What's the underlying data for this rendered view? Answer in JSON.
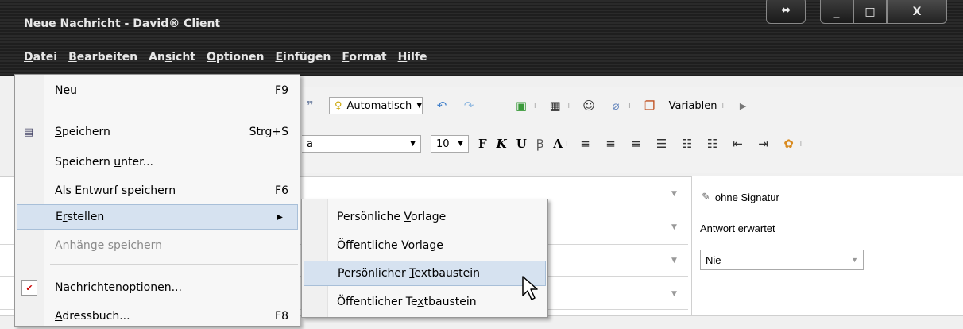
{
  "window": {
    "title": "Neue Nachricht - David® Client",
    "buttons": {
      "resize_icon": "⇔",
      "minimize_icon": "_",
      "maximize_icon": "□",
      "close_icon": "X"
    }
  },
  "menubar": [
    {
      "key": "D",
      "rest": "atei"
    },
    {
      "key": "B",
      "rest": "earbeiten"
    },
    {
      "pre": "An",
      "key": "s",
      "rest": "icht"
    },
    {
      "key": "O",
      "rest": "ptionen"
    },
    {
      "key": "E",
      "rest": "infügen"
    },
    {
      "key": "F",
      "rest": "ormat"
    },
    {
      "key": "H",
      "rest": "ilfe"
    }
  ],
  "toolbar": {
    "priority": "Automatisch",
    "variables": "Variablen",
    "font_partial": "a",
    "font_size": "10",
    "bold": "F",
    "italic": "K",
    "underline": "U",
    "strike": "Ꞵ",
    "color": "A"
  },
  "side": {
    "signature": "ohne Signatur",
    "reply_label": "Antwort erwartet",
    "reply_value": "Nie"
  },
  "file_menu": {
    "items": [
      {
        "pre": "",
        "key": "N",
        "rest": "eu",
        "shortcut": "F9"
      },
      {
        "pre": "",
        "key": "S",
        "rest": "peichern",
        "shortcut": "Strg+S"
      },
      {
        "pre": "Speichern ",
        "key": "u",
        "rest": "nter...",
        "shortcut": ""
      },
      {
        "pre": "Als Ent",
        "key": "w",
        "rest": "urf speichern",
        "shortcut": "F6"
      },
      {
        "pre": "E",
        "key": "r",
        "rest": "stellen",
        "shortcut": ""
      },
      {
        "pre": "Anhän",
        "key": "g",
        "rest": "e speichern",
        "shortcut": ""
      },
      {
        "pre": "Nachrichten",
        "key": "o",
        "rest": "ptionen...",
        "shortcut": ""
      },
      {
        "pre": "",
        "key": "A",
        "rest": "dressbuch...",
        "shortcut": "F8"
      }
    ]
  },
  "submenu": {
    "items": [
      {
        "pre": "Persönliche ",
        "key": "V",
        "rest": "orlage"
      },
      {
        "pre": "Ö",
        "key": "f",
        "rest": "fentliche Vorlage"
      },
      {
        "pre": "Persönlicher ",
        "key": "T",
        "rest": "extbaustein"
      },
      {
        "pre": "Öffentlicher Te",
        "key": "x",
        "rest": "tbaustein"
      }
    ]
  }
}
